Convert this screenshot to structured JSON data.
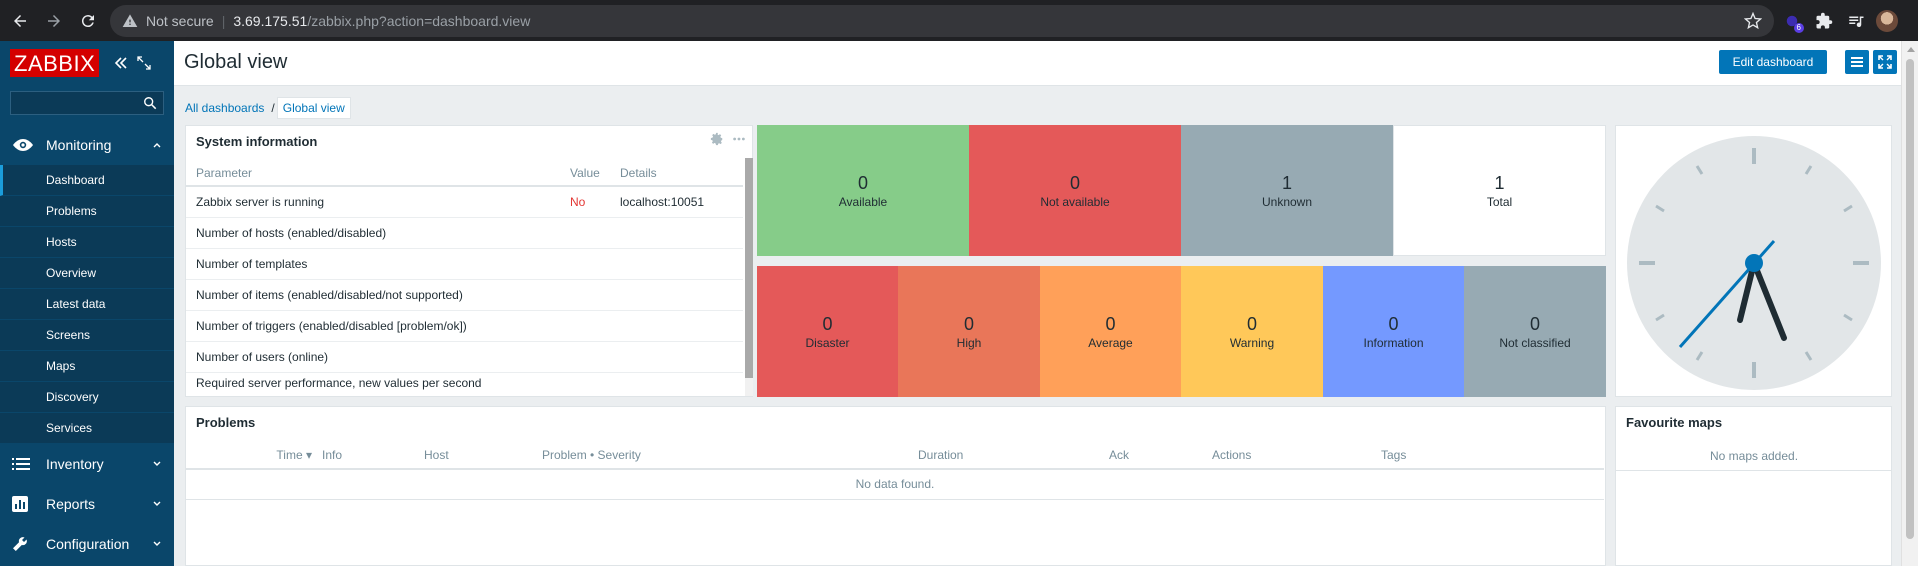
{
  "browser": {
    "security_label": "Not secure",
    "url_host": "3.69.175.51",
    "url_path": "/zabbix.php?action=dashboard.view",
    "extension_badge": "6"
  },
  "sidebar": {
    "logo": "ZABBIX",
    "search_value": "",
    "sections": [
      {
        "label": "Monitoring",
        "icon": "eye-icon",
        "expanded": true
      },
      {
        "label": "Inventory",
        "icon": "list-icon",
        "expanded": false
      },
      {
        "label": "Reports",
        "icon": "bar-chart-icon",
        "expanded": false
      },
      {
        "label": "Configuration",
        "icon": "wrench-icon",
        "expanded": false
      }
    ],
    "monitoring_items": [
      "Dashboard",
      "Problems",
      "Hosts",
      "Overview",
      "Latest data",
      "Screens",
      "Maps",
      "Discovery",
      "Services"
    ],
    "active_item": "Dashboard"
  },
  "header": {
    "title": "Global view",
    "edit_button": "Edit dashboard"
  },
  "breadcrumb": {
    "items": [
      "All dashboards",
      "Global view"
    ]
  },
  "system_info": {
    "title": "System information",
    "columns": [
      "Parameter",
      "Value",
      "Details"
    ],
    "rows": [
      [
        "Zabbix server is running",
        "No",
        "localhost:10051"
      ],
      [
        "Number of hosts (enabled/disabled)",
        "",
        ""
      ],
      [
        "Number of templates",
        "",
        ""
      ],
      [
        "Number of items (enabled/disabled/not supported)",
        "",
        ""
      ],
      [
        "Number of triggers (enabled/disabled [problem/ok])",
        "",
        ""
      ],
      [
        "Number of users (online)",
        "",
        ""
      ],
      [
        "Required server performance, new values per second",
        "",
        ""
      ]
    ]
  },
  "host_availability": [
    {
      "count": "0",
      "label": "Available",
      "color": "#86cc89"
    },
    {
      "count": "0",
      "label": "Not available",
      "color": "#e45959"
    },
    {
      "count": "1",
      "label": "Unknown",
      "color": "#97aab3"
    },
    {
      "count": "1",
      "label": "Total",
      "color": "#ffffff"
    }
  ],
  "problems_by_severity": [
    {
      "count": "0",
      "label": "Disaster",
      "color": "#e45959"
    },
    {
      "count": "0",
      "label": "High",
      "color": "#e97659"
    },
    {
      "count": "0",
      "label": "Average",
      "color": "#ffa059"
    },
    {
      "count": "0",
      "label": "Warning",
      "color": "#ffc859"
    },
    {
      "count": "0",
      "label": "Information",
      "color": "#7499ff"
    },
    {
      "count": "0",
      "label": "Not classified",
      "color": "#97aab3"
    }
  ],
  "problems": {
    "title": "Problems",
    "columns": [
      "Time ▾",
      "Info",
      "Host",
      "Problem • Severity",
      "Duration",
      "Ack",
      "Actions",
      "Tags"
    ],
    "empty_text": "No data found."
  },
  "favourite_maps": {
    "title": "Favourite maps",
    "empty_text": "No maps added."
  },
  "colors": {
    "sidebar": "#0a466a",
    "accent": "#0275b8",
    "logo": "#d40000"
  }
}
